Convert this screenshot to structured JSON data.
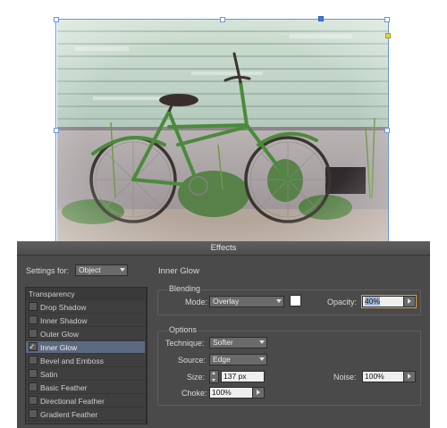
{
  "dialog": {
    "title": "Effects",
    "settings_for_label": "Settings for:",
    "settings_for_value": "Object",
    "panel_title": "Inner Glow"
  },
  "effects_list": [
    {
      "label": "Transparency",
      "checked": null,
      "selected": false
    },
    {
      "label": "Drop Shadow",
      "checked": false,
      "selected": false
    },
    {
      "label": "Inner Shadow",
      "checked": false,
      "selected": false
    },
    {
      "label": "Outer Glow",
      "checked": false,
      "selected": false
    },
    {
      "label": "Inner Glow",
      "checked": true,
      "selected": true
    },
    {
      "label": "Bevel and Emboss",
      "checked": false,
      "selected": false
    },
    {
      "label": "Satin",
      "checked": false,
      "selected": false
    },
    {
      "label": "Basic Feather",
      "checked": false,
      "selected": false
    },
    {
      "label": "Directional Feather",
      "checked": false,
      "selected": false
    },
    {
      "label": "Gradient Feather",
      "checked": false,
      "selected": false
    }
  ],
  "blending": {
    "group_label": "Blending",
    "mode_label": "Mode:",
    "mode_value": "Overlay",
    "glow_color": "#ffffff",
    "opacity_label": "Opacity:",
    "opacity_value": "40%"
  },
  "options": {
    "group_label": "Options",
    "technique_label": "Technique:",
    "technique_value": "Softer",
    "source_label": "Source:",
    "source_value": "Edge",
    "size_label": "Size:",
    "size_value": "137 px",
    "noise_label": "Noise:",
    "noise_value": "100%",
    "choke_label": "Choke:",
    "choke_value": "100%"
  },
  "colors": {
    "dialog_bg": "#4a4a4a",
    "selection_blue": "#6b97d6",
    "list_selected": "#5b6a80"
  }
}
